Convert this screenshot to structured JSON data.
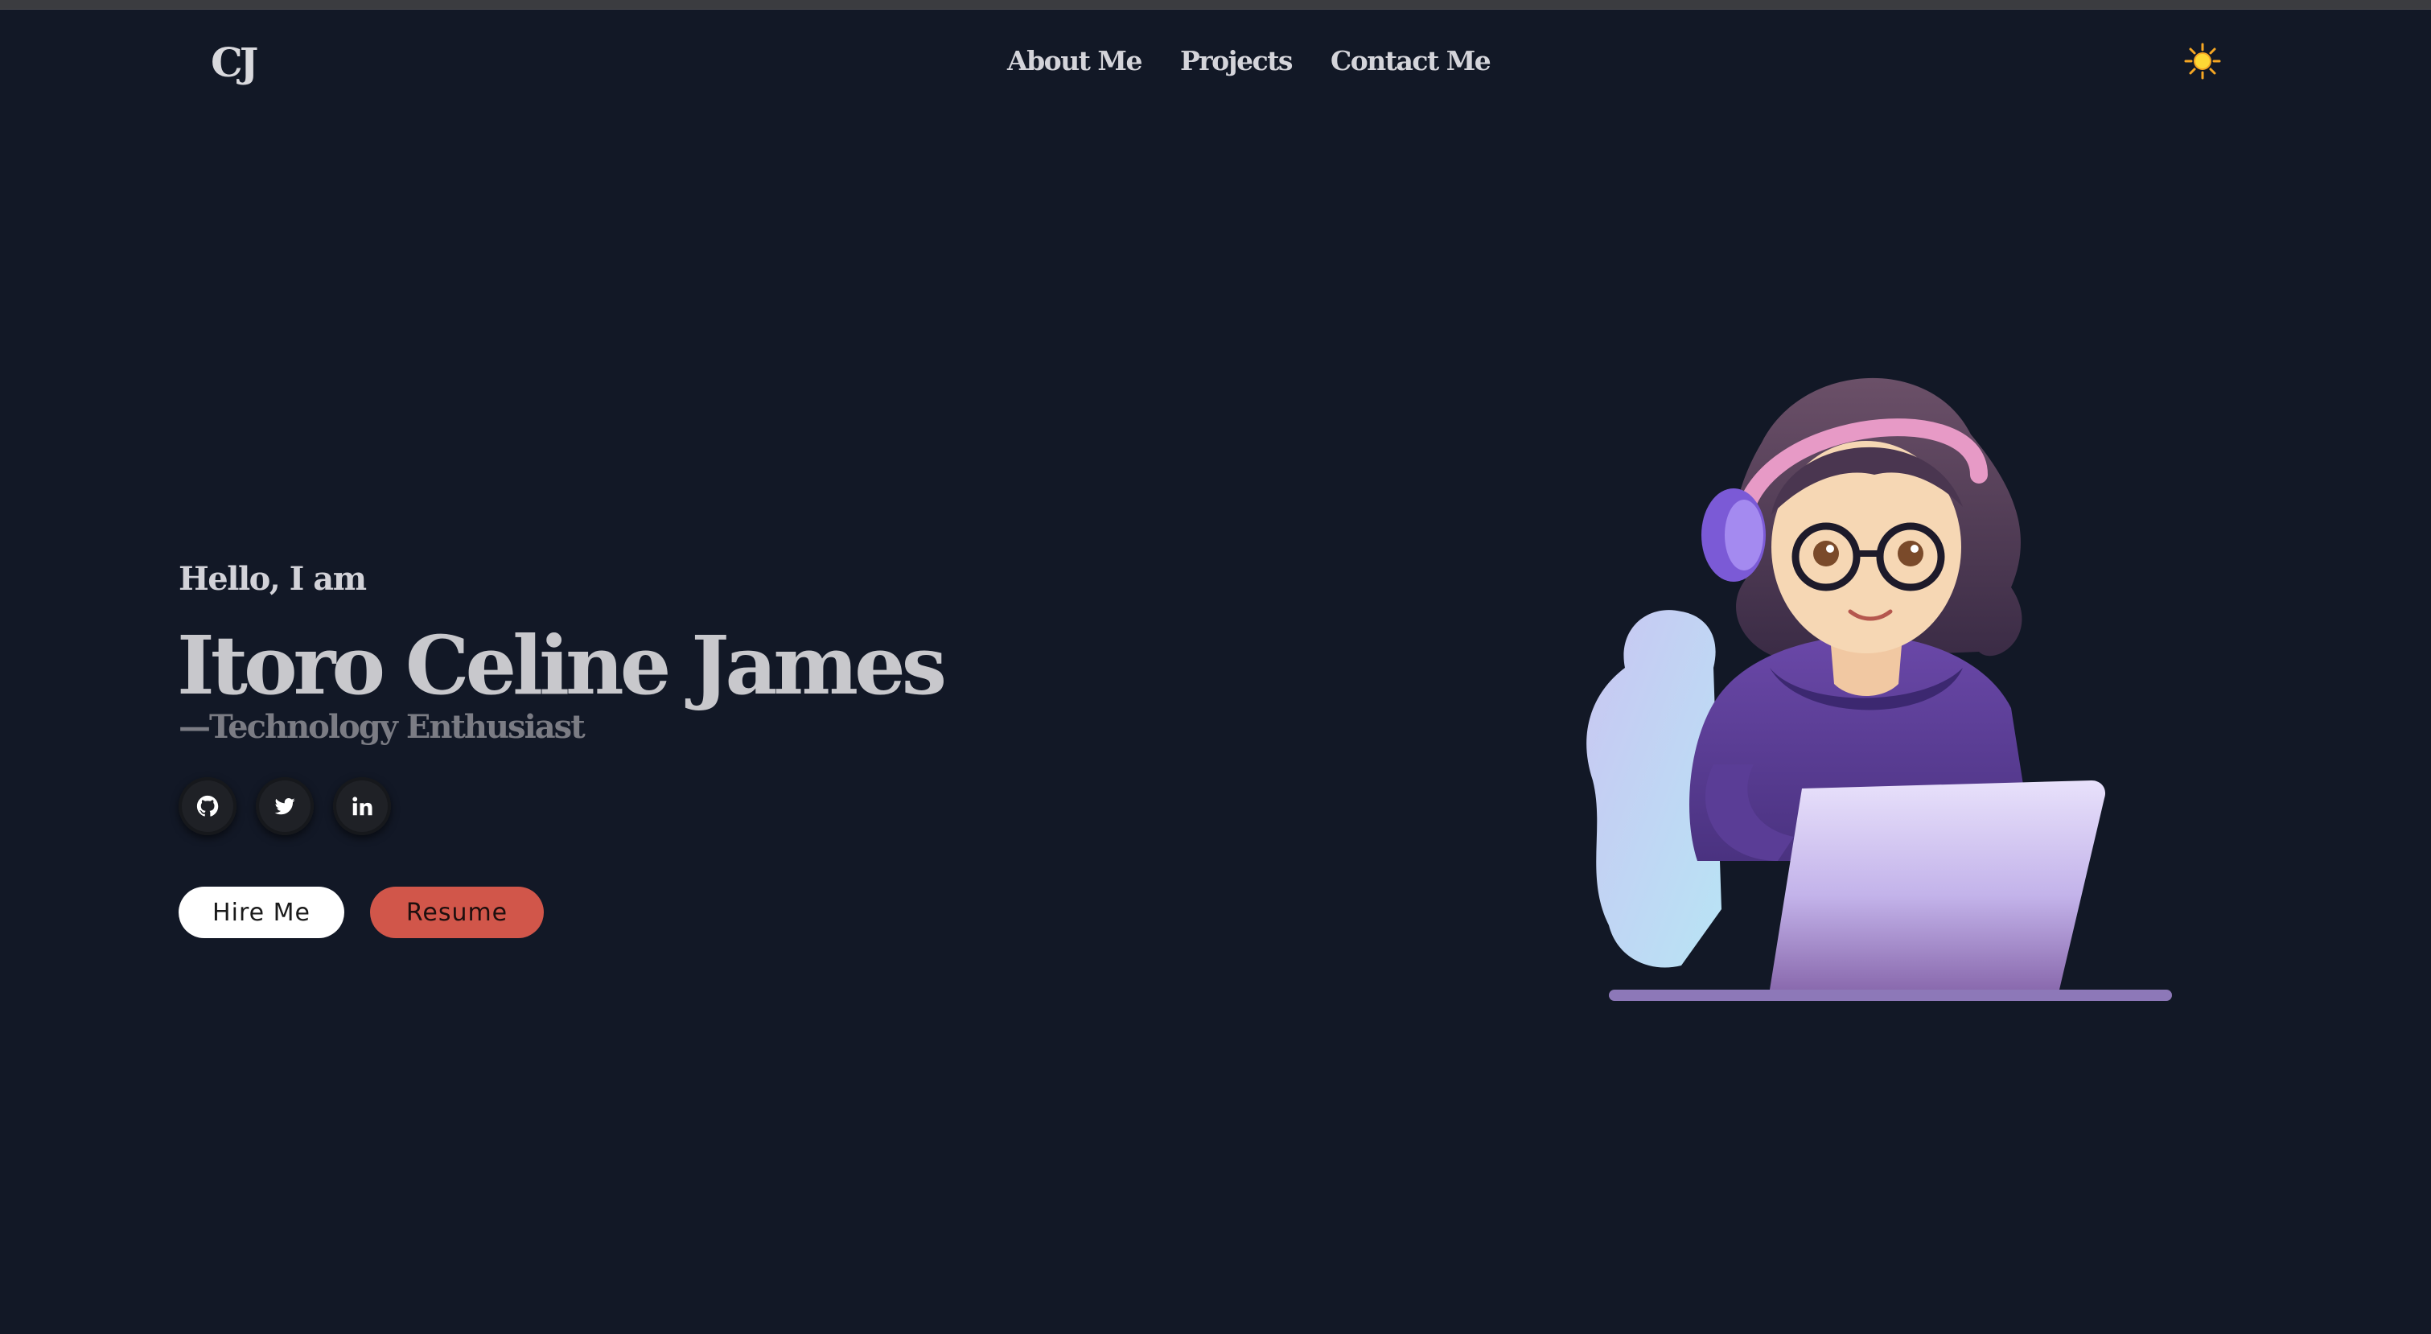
{
  "header": {
    "logo": "CJ",
    "nav": [
      "About Me",
      "Projects",
      "Contact Me"
    ],
    "theme_toggle_icon": "sun-icon"
  },
  "hero": {
    "greeting": "Hello, I am",
    "name": "Itoro Celine James",
    "tagline": "—Technology Enthusiast",
    "socials": [
      "github-icon",
      "twitter-icon",
      "linkedin-icon"
    ],
    "buttons": {
      "hire": "Hire Me",
      "resume": "Resume"
    },
    "illustration": "avatar-illustration"
  },
  "colors": {
    "background": "#121826",
    "accent": "#d1564a",
    "text": "#d4d4da",
    "muted": "#7b7c84"
  }
}
